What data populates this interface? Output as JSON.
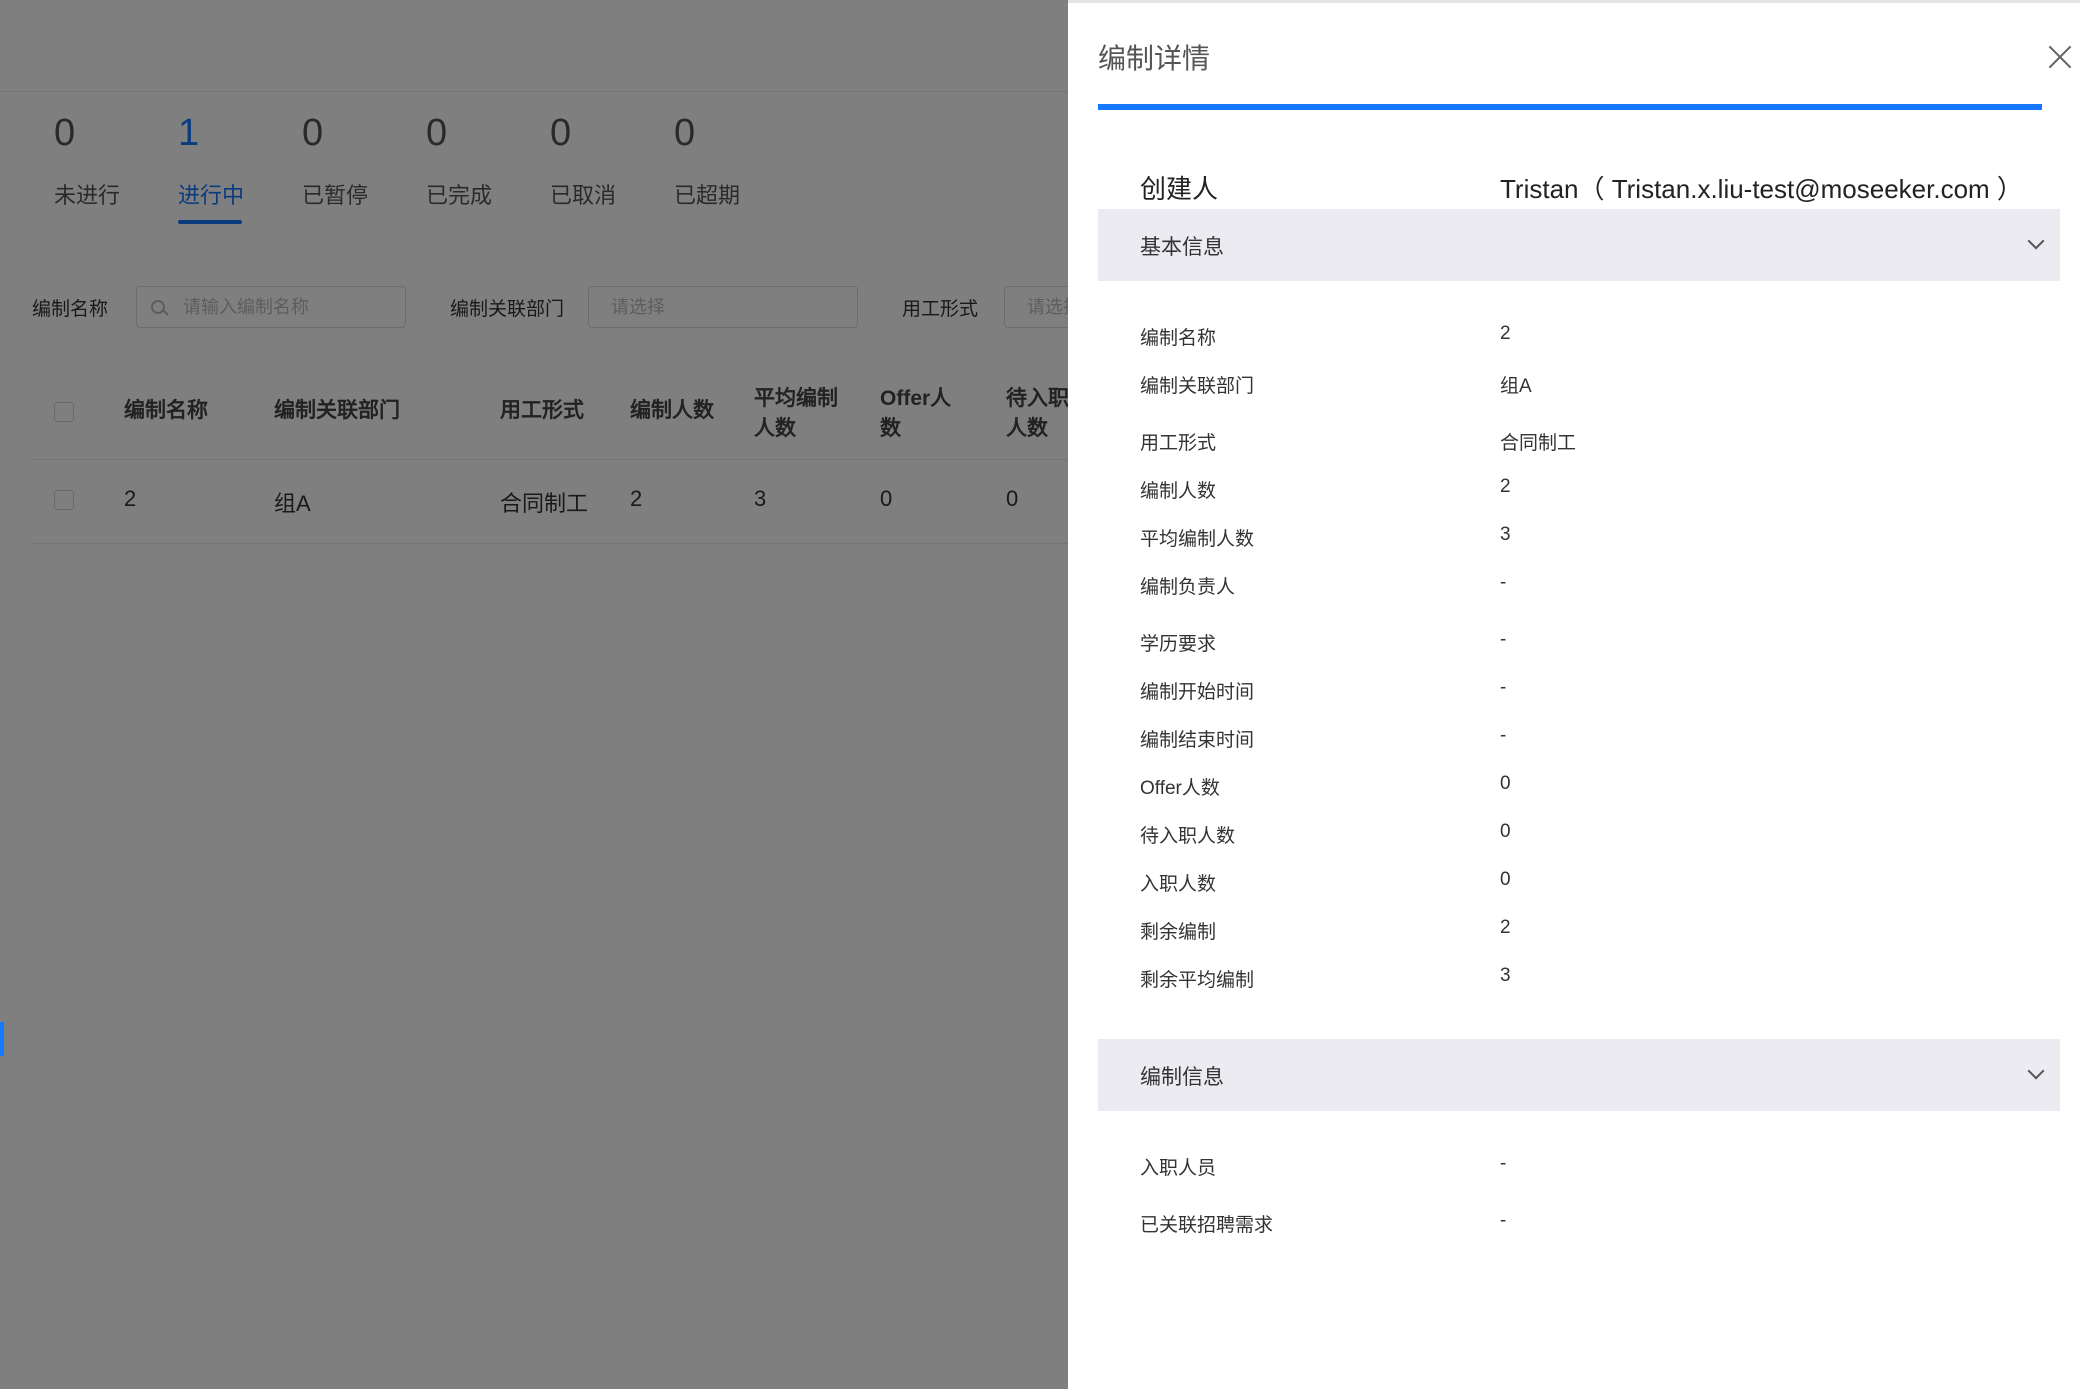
{
  "stat_tabs": [
    {
      "count": "0",
      "label": "未进行"
    },
    {
      "count": "1",
      "label": "进行中"
    },
    {
      "count": "0",
      "label": "已暂停"
    },
    {
      "count": "0",
      "label": "已完成"
    },
    {
      "count": "0",
      "label": "已取消"
    },
    {
      "count": "0",
      "label": "已超期"
    }
  ],
  "filters": {
    "name_label": "编制名称",
    "name_placeholder": "请输入编制名称",
    "dept_label": "编制关联部门",
    "dept_placeholder": "请选择",
    "type_label": "用工形式",
    "type_placeholder": "请选择"
  },
  "table": {
    "headers": [
      "编制名称",
      "编制关联部门",
      "用工形式",
      "编制人数",
      "平均编制人数",
      "Offer人数",
      "待入职人数"
    ],
    "rows": [
      [
        "2",
        "组A",
        "合同制工",
        "2",
        "3",
        "0",
        "0"
      ]
    ]
  },
  "drawer": {
    "title": "编制详情",
    "progress": 1.0,
    "creator_label": "创建人",
    "creator_value": "Tristan（ Tristan.x.liu-test@moseeker.com ）",
    "section_basic": "基本信息",
    "basic_fields": [
      {
        "label": "编制名称",
        "value": "2"
      },
      {
        "label": "编制关联部门",
        "value": "组A"
      },
      {
        "label": "用工形式",
        "value": "合同制工"
      },
      {
        "label": "编制人数",
        "value": "2"
      },
      {
        "label": "平均编制人数",
        "value": "3"
      },
      {
        "label": "编制负责人",
        "value": "-"
      },
      {
        "label": "学历要求",
        "value": "-"
      },
      {
        "label": "编制开始时间",
        "value": "-"
      },
      {
        "label": "编制结束时间",
        "value": "-"
      },
      {
        "label": "Offer人数",
        "value": "0"
      },
      {
        "label": "待入职人数",
        "value": "0"
      },
      {
        "label": "入职人数",
        "value": "0"
      },
      {
        "label": "剩余编制",
        "value": "2"
      },
      {
        "label": "剩余平均编制",
        "value": "3"
      }
    ],
    "section_info": "编制信息",
    "info_fields": [
      {
        "label": "入职人员",
        "value": "-"
      },
      {
        "label": "已关联招聘需求",
        "value": "-"
      }
    ]
  },
  "colors": {
    "accent": "#1677ff",
    "section_bg": "#ecebf1",
    "overlay": "rgba(0,0,0,0.5)"
  },
  "icons": [
    "search-icon",
    "close-icon",
    "chevron-down-icon"
  ]
}
